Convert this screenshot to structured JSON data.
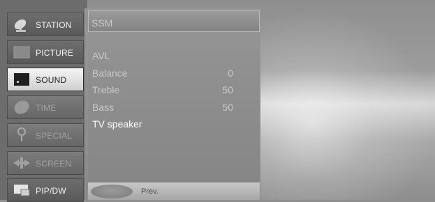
{
  "menu": {
    "items": [
      {
        "label": "STATION",
        "icon": "satellite-dish-icon",
        "state": "normal"
      },
      {
        "label": "PICTURE",
        "icon": "picture-icon",
        "state": "normal"
      },
      {
        "label": "SOUND",
        "icon": "speaker-icon",
        "state": "selected"
      },
      {
        "label": "TIME",
        "icon": "clock-icon",
        "state": "dimmed"
      },
      {
        "label": "SPECIAL",
        "icon": "key-icon",
        "state": "dimmed"
      },
      {
        "label": "SCREEN",
        "icon": "screen-arrows-icon",
        "state": "dimmed"
      },
      {
        "label": "PIP/DW",
        "icon": "pip-icon",
        "state": "normal"
      }
    ]
  },
  "sound": {
    "ssm_label": "SSM",
    "settings": [
      {
        "name": "AVL",
        "value": "",
        "state": "dim"
      },
      {
        "name": "Balance",
        "value": "0",
        "state": "dim"
      },
      {
        "name": "Treble",
        "value": "50",
        "state": "dim"
      },
      {
        "name": "Bass",
        "value": "50",
        "state": "dim"
      },
      {
        "name": "TV speaker",
        "value": "",
        "state": "bright"
      }
    ]
  },
  "footer": {
    "prev_label": "Prev."
  }
}
